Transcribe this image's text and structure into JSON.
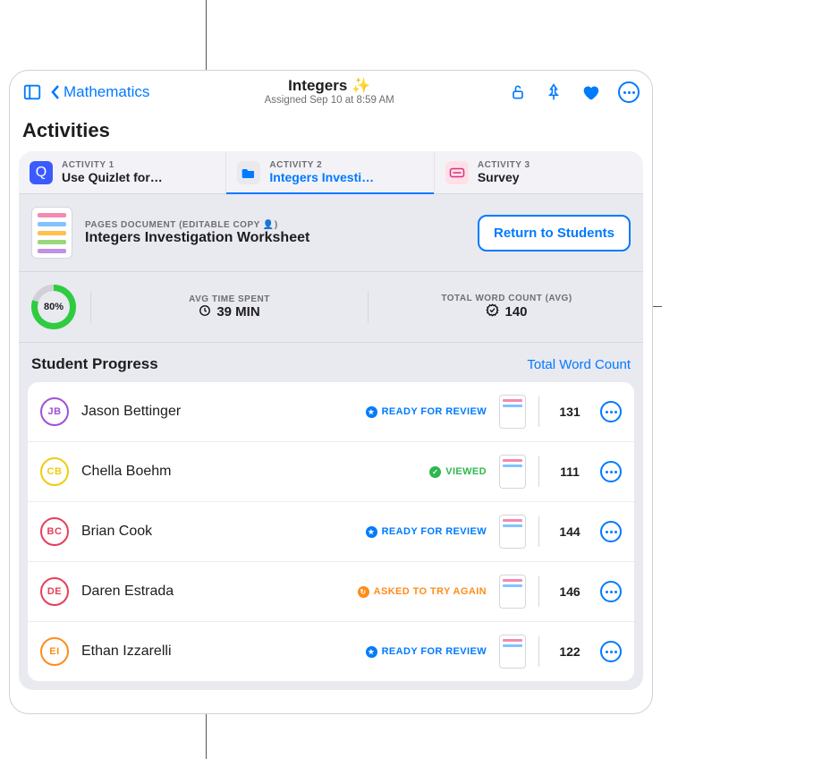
{
  "header": {
    "back_label": "Mathematics",
    "title": "Integers ✨",
    "subtitle": "Assigned Sep 10 at 8:59 AM"
  },
  "section_title": "Activities",
  "tabs": [
    {
      "over": "ACTIVITY 1",
      "label": "Use Quizlet for…"
    },
    {
      "over": "ACTIVITY 2",
      "label": "Integers Investi…"
    },
    {
      "over": "ACTIVITY 3",
      "label": "Survey"
    }
  ],
  "document": {
    "over": "PAGES DOCUMENT (EDITABLE COPY 👤)",
    "title": "Integers Investigation Worksheet",
    "return_button": "Return to Students"
  },
  "stats": {
    "ring_pct": "80%",
    "time_label": "AVG TIME SPENT",
    "time_value": "39 MIN",
    "words_label": "TOTAL WORD COUNT (AVG)",
    "words_value": "140"
  },
  "progress": {
    "title": "Student Progress",
    "filter": "Total Word Count"
  },
  "status_labels": {
    "ready": "READY FOR REVIEW",
    "viewed": "VIEWED",
    "tryagain": "ASKED TO TRY AGAIN"
  },
  "students": [
    {
      "initials": "JB",
      "name": "Jason Bettinger",
      "status": "ready",
      "count": "131",
      "avatar": "purple"
    },
    {
      "initials": "CB",
      "name": "Chella Boehm",
      "status": "viewed",
      "count": "111",
      "avatar": "yellow"
    },
    {
      "initials": "BC",
      "name": "Brian Cook",
      "status": "ready",
      "count": "144",
      "avatar": "red"
    },
    {
      "initials": "DE",
      "name": "Daren Estrada",
      "status": "tryagain",
      "count": "146",
      "avatar": "red"
    },
    {
      "initials": "EI",
      "name": "Ethan Izzarelli",
      "status": "ready",
      "count": "122",
      "avatar": "orange"
    }
  ]
}
